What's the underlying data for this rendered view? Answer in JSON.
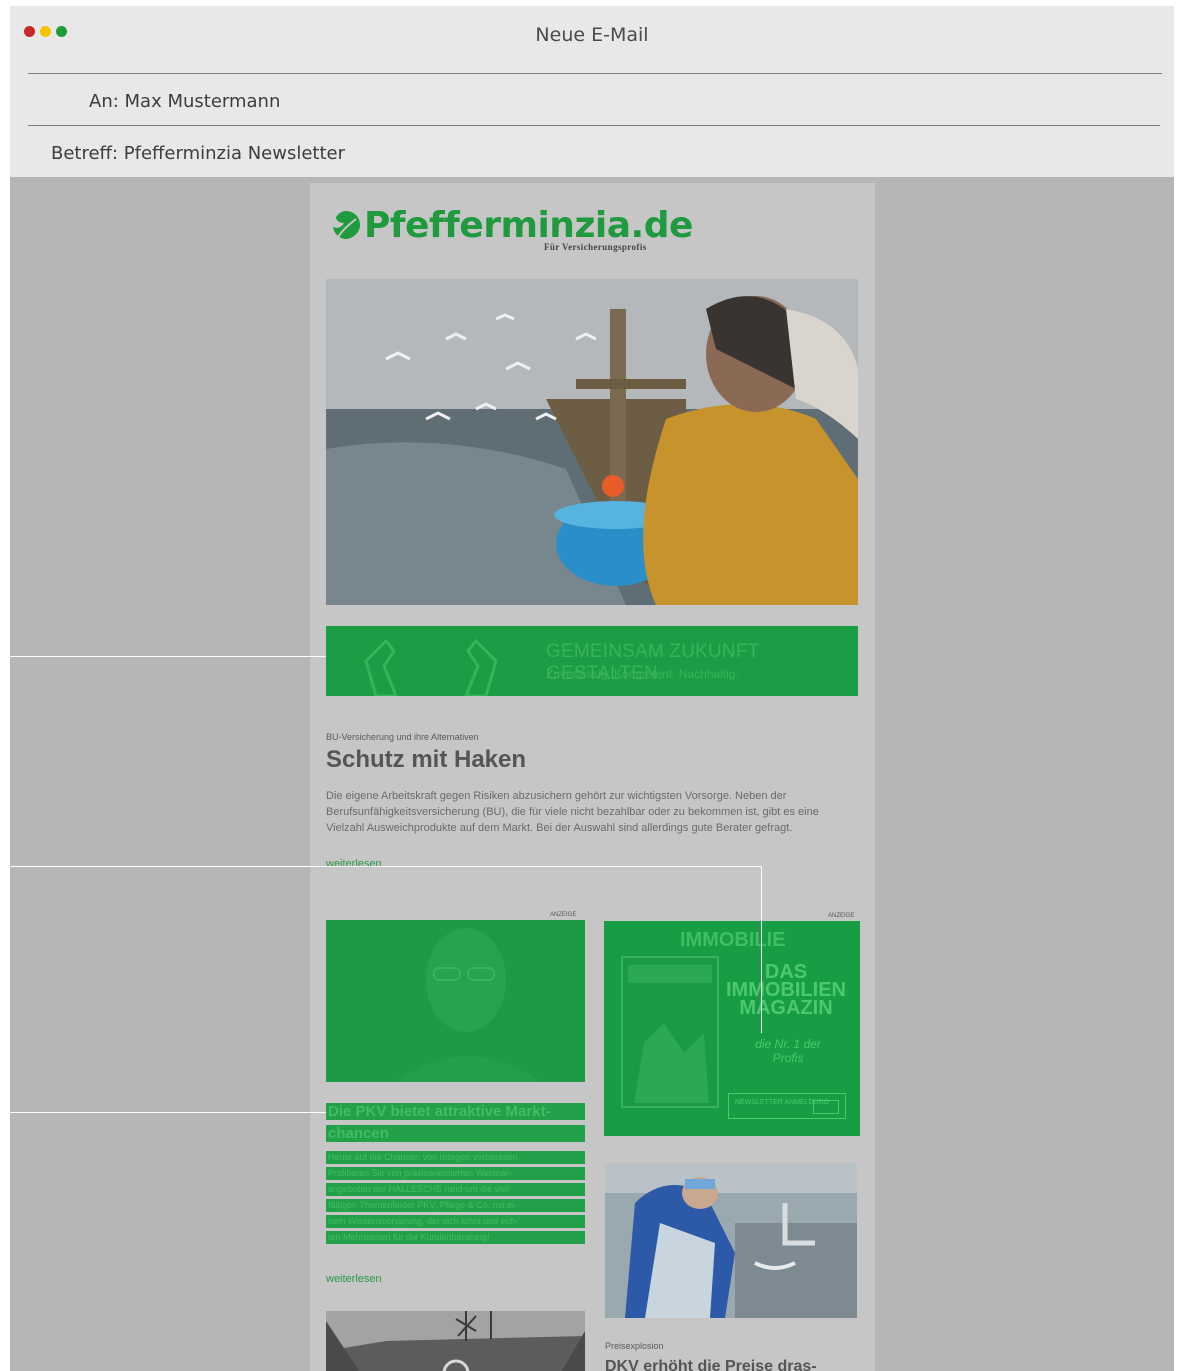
{
  "window": {
    "title": "Neue E-Mail",
    "to_label": "An: Max Mustermann",
    "subject_label": "Betreff: Pfefferminzia Newsletter",
    "colors": {
      "close": "#c62828",
      "minimize": "#f5c400",
      "maximize": "#1e9e3a"
    }
  },
  "newsletter": {
    "logo_text": "Pfefferminzia.de",
    "logo_sub": "Für Versicherungsprofis",
    "banner": {
      "title": "GEMEINSAM ZUKUNFT GESTALTEN.",
      "subtitle": "Zuverlässig. Kompetent. Nachhaltig."
    },
    "article": {
      "kicker": "BU-Versicherung und ihre Alternativen",
      "headline": "Schutz mit Haken",
      "body": "Die eigene Arbeitskraft gegen Risiken abzusichern gehört zur wichtigsten Vorsorge. Neben der Berufsunfähigkeitsversicherung (BU), die für viele nicht bezahlbar oder zu bekommen ist, gibt es eine Vielzahl Ausweichprodukte auf dem Markt. Bei der Auswahl sind allerdings gute Berater gefragt.",
      "more": "weiterlesen"
    },
    "ad_label_left": "ANZEIGE",
    "ad_label_right": "ANZEIGE",
    "immobilie": {
      "logo": "IMMOBILIE",
      "big": "DAS IMMOBILIEN MAGAZIN",
      "small": "die Nr. 1 der Profis",
      "button": "NEWSLETTER ANMELDUNG"
    },
    "pkv": {
      "title_line1": "Die PKV bietet attraktive Markt-",
      "title_line2": "chancen",
      "lines": [
        "Heute auf die Chancen von morgen vorbereiten",
        "Profitieren Sie von praxisorientierten Webinar-",
        "angeboten der HALLESCHE rund um die viel-",
        "fältigen Themenfelder PKV, Pflege & Co. mit ei-",
        "nem Wissensvorsprung, der sich lohnt und ech-",
        "ten Mehrwerten für die Kundenberatung!"
      ],
      "more": "weiterlesen"
    },
    "dkv": {
      "kicker": "Preisexplosion",
      "headline": "DKV erhöht die Preise dras-"
    }
  }
}
